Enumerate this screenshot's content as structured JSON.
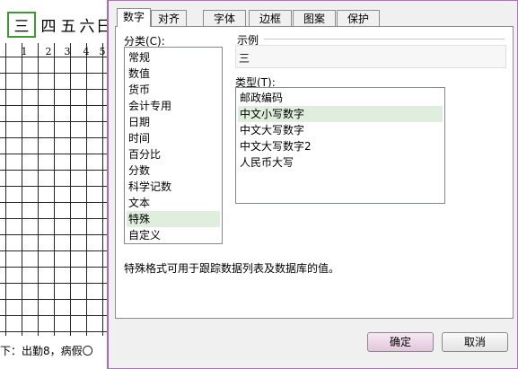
{
  "sheet": {
    "header_cells": [
      "三",
      "四",
      "五",
      "六",
      "日"
    ],
    "number_cells": [
      "1",
      "2",
      "3",
      "4",
      "5"
    ],
    "footer_text": "下：出勤8，病假〇"
  },
  "dialog": {
    "tabs": [
      {
        "label": "数字",
        "active": true
      },
      {
        "label": "对齐",
        "active": false
      },
      {
        "label": "字体",
        "active": false
      },
      {
        "label": "边框",
        "active": false
      },
      {
        "label": "图案",
        "active": false
      },
      {
        "label": "保护",
        "active": false
      }
    ],
    "category_label": "分类(C):",
    "categories": [
      {
        "label": "常规",
        "selected": false
      },
      {
        "label": "数值",
        "selected": false
      },
      {
        "label": "货币",
        "selected": false
      },
      {
        "label": "会计专用",
        "selected": false
      },
      {
        "label": "日期",
        "selected": false
      },
      {
        "label": "时间",
        "selected": false
      },
      {
        "label": "百分比",
        "selected": false
      },
      {
        "label": "分数",
        "selected": false
      },
      {
        "label": "科学记数",
        "selected": false
      },
      {
        "label": "文本",
        "selected": false
      },
      {
        "label": "特殊",
        "selected": true
      },
      {
        "label": "自定义",
        "selected": false
      }
    ],
    "sample_label": "示例",
    "sample_value": "三",
    "type_label": "类型(T):",
    "types": [
      {
        "label": "邮政编码",
        "selected": false
      },
      {
        "label": "中文小写数字",
        "selected": true
      },
      {
        "label": "中文大写数字",
        "selected": false
      },
      {
        "label": "中文大写数字2",
        "selected": false
      },
      {
        "label": "人民币大写",
        "selected": false
      }
    ],
    "description": "特殊格式可用于跟踪数据列表及数据库的值。",
    "ok_label": "确定",
    "cancel_label": "取消"
  },
  "colors": {
    "selection_border": "#3e9a35",
    "list_selected_bg": "#dfeedd",
    "dialog_border": "#b46cc4"
  }
}
